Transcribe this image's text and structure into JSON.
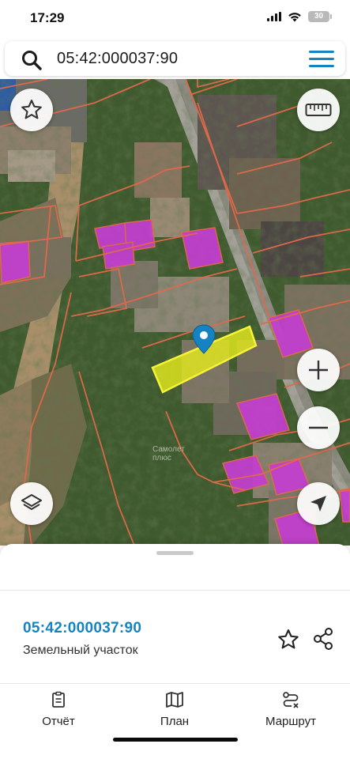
{
  "status_bar": {
    "time": "17:29",
    "battery": "30"
  },
  "search": {
    "query": "05:42:000037:90",
    "icon": "search-icon",
    "menu_icon": "hamburger-menu-icon"
  },
  "map": {
    "watermark_line1": "Самолет",
    "watermark_line2": "плюс",
    "selected_parcel_color": "#e6ec1c",
    "boundary_color": "#e2694a",
    "building_color": "#c33fd0",
    "marker_color": "#1583c1",
    "buttons": {
      "favorite": "star-icon",
      "ruler": "ruler-icon",
      "zoom_in": "plus-icon",
      "zoom_out": "minus-icon",
      "layers": "layers-icon",
      "locate": "location-arrow-icon"
    }
  },
  "sheet": {
    "cadastral_number": "05:42:000037:90",
    "parcel_type": "Земельный участок",
    "accent_color": "#1583c1"
  },
  "tabs": [
    {
      "label": "Отчёт",
      "icon": "report-icon"
    },
    {
      "label": "План",
      "icon": "map-plan-icon"
    },
    {
      "label": "Маршрут",
      "icon": "route-icon"
    }
  ]
}
